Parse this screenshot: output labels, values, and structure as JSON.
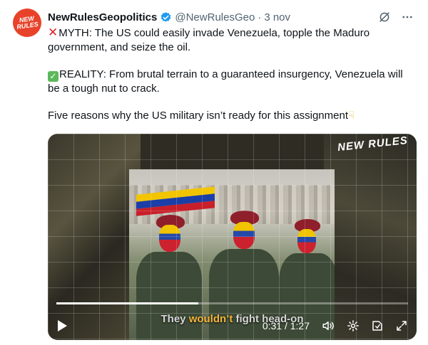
{
  "tweet": {
    "avatar_text": "NEW RULES",
    "author_name": "NewRulesGeopolitics",
    "handle": "@NewRulesGeo",
    "separator": "·",
    "date": "3 nov",
    "lines": {
      "myth": "MYTH: The US could easily invade Venezuela, topple the Maduro government, and seize the oil.",
      "reality": "REALITY: From brutal terrain to a guaranteed insurgency, Venezuela will be a tough nut to crack.",
      "reasons": "Five reasons why the US military isn’t ready for this assignment"
    },
    "icons": {
      "verified": "verified-badge-icon",
      "grok": "grok-icon",
      "more": "more-icon",
      "myth": "cross-mark-icon",
      "reality": "check-mark-icon",
      "point": "pointing-down-icon"
    },
    "colors": {
      "accent": "#1d9bf0",
      "secondary_text": "#536471",
      "caption_highlight": "#f4b63b"
    }
  },
  "video": {
    "watermark": "NEW RULES",
    "caption_before": "They ",
    "caption_highlight": "wouldn’t",
    "caption_after": " fight head-on",
    "progress": 0.404,
    "time": "0:31 / 1:27"
  }
}
